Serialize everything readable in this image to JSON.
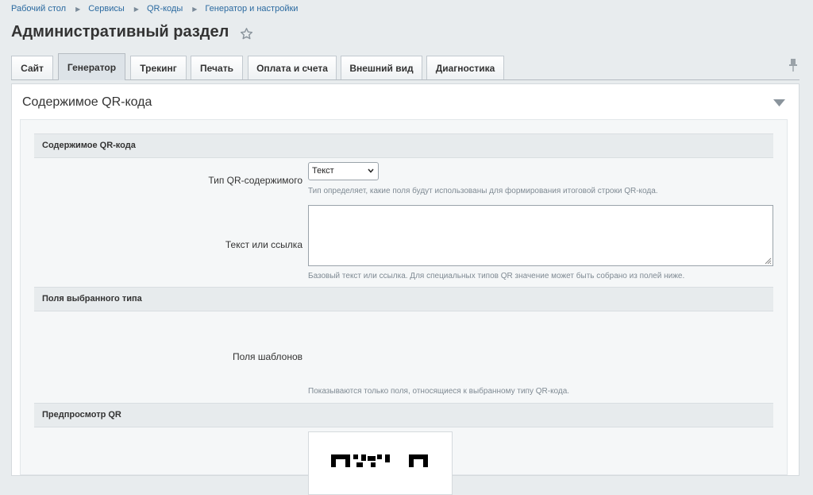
{
  "breadcrumb": [
    "Рабочий стол",
    "Сервисы",
    "QR-коды",
    "Генератор и настройки"
  ],
  "page_title": "Административный раздел",
  "tabs": [
    {
      "label": "Сайт"
    },
    {
      "label": "Генератор"
    },
    {
      "label": "Трекинг"
    },
    {
      "label": "Печать"
    },
    {
      "label": "Оплата и счета"
    },
    {
      "label": "Внешний вид"
    },
    {
      "label": "Диагностика"
    }
  ],
  "active_tab": "Генератор",
  "panel": {
    "title": "Содержимое QR-кода",
    "sections": {
      "content": {
        "header": "Содержимое QR-кода",
        "type_label": "Тип QR-содержимого",
        "type_value": "Текст",
        "type_hint": "Тип определяет, какие поля будут использованы для формирования итоговой строки QR-кода.",
        "text_label": "Текст или ссылка",
        "text_value": "",
        "text_hint": "Базовый текст или ссылка. Для специальных типов QR значение может быть собрано из полей ниже."
      },
      "fields": {
        "header": "Поля выбранного типа",
        "templates_label": "Поля шаблонов",
        "templates_hint": "Показываются только поля, относящиеся к выбранному типу QR-кода."
      },
      "preview": {
        "header": "Предпросмотр QR"
      }
    }
  },
  "icons": {
    "favorite": "star-icon",
    "pin": "pin-icon",
    "collapse": "collapse-icon",
    "select_arrow": "chevron-down-icon"
  },
  "colors": {
    "link": "#2b6aa0",
    "background": "#e8ecee",
    "section_header": "#e7ebed",
    "hint": "#7f8a93"
  }
}
